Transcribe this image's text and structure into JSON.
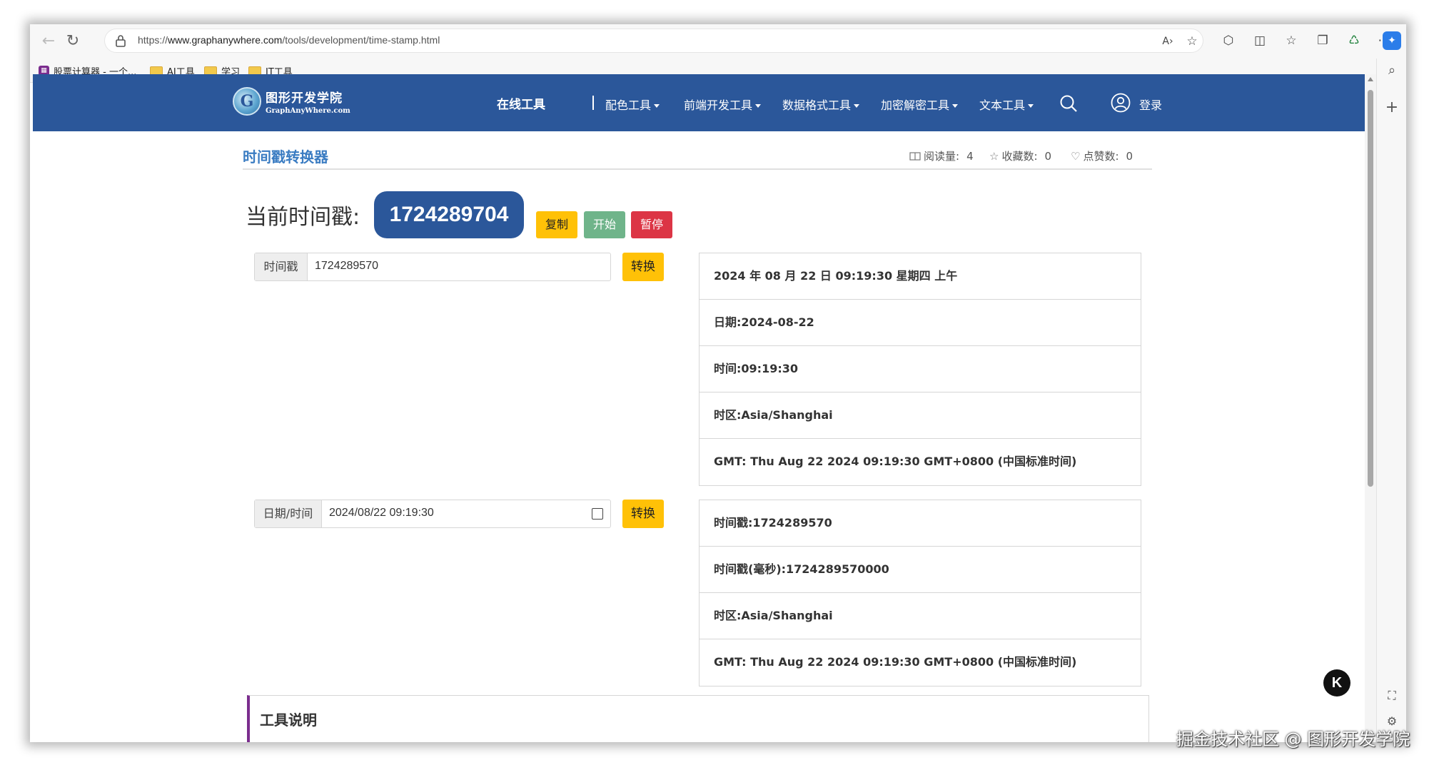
{
  "browser": {
    "url_prefix": "https://",
    "url_host": "www.graphanywhere.com",
    "url_path": "/tools/development/time-stamp.html",
    "bookmarks": [
      {
        "label": "股票计算器 - 一个..."
      },
      {
        "label": "AI工具"
      },
      {
        "label": "学习"
      },
      {
        "label": "IT工具"
      }
    ]
  },
  "site": {
    "logo_title": "图形开发学院",
    "logo_sub": "GraphAnyWhere.com",
    "nav_main": "在线工具",
    "nav_items": [
      "配色工具",
      "前端开发工具",
      "数据格式工具",
      "加密解密工具",
      "文本工具"
    ],
    "login": "登录"
  },
  "page": {
    "title": "时间戳转换器",
    "stats": {
      "read_label": "阅读量:",
      "read_value": "4",
      "fav_label": "收藏数:",
      "fav_value": "0",
      "like_label": "点赞数:",
      "like_value": "0"
    },
    "current_label": "当前时间戳:",
    "current_value": "1724289704",
    "buttons": {
      "copy": "复制",
      "start": "开始",
      "pause": "暂停"
    }
  },
  "converter1": {
    "label": "时间戳",
    "value": "1724289570",
    "button": "转换",
    "results": [
      "2024 年 08 月 22 日 09:19:30 星期四 上午",
      "日期:2024-08-22",
      "时间:09:19:30",
      "时区:Asia/Shanghai",
      "GMT:  Thu Aug 22 2024 09:19:30 GMT+0800 (中国标准时间)"
    ]
  },
  "converter2": {
    "label": "日期/时间",
    "value": "2024/08/22 09:19:30",
    "button": "转换",
    "results": [
      "时间戳:1724289570",
      "时间戳(毫秒):1724289570000",
      "时区:Asia/Shanghai",
      "GMT:  Thu Aug 22 2024 09:19:30 GMT+0800 (中国标准时间)"
    ]
  },
  "description": {
    "title": "工具说明"
  },
  "float_button": "K",
  "watermark": "掘金技术社区 @ 图形开发学院",
  "colors": {
    "header_blue": "#2b579a",
    "title_blue": "#3a7cc2",
    "copy_yellow": "#ffc107",
    "start_green": "#6fb48a",
    "pause_red": "#dc3545",
    "desc_accent": "#7b2d8e"
  }
}
